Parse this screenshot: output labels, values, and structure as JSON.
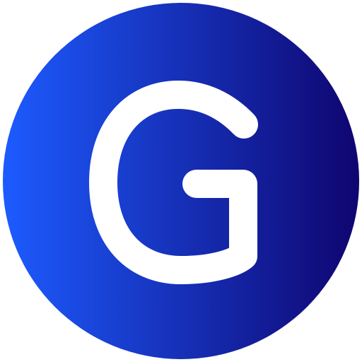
{
  "logo": {
    "name": "G",
    "gradient_start": "#1d5bff",
    "gradient_end": "#0f0570",
    "glyph_color": "#ffffff"
  }
}
